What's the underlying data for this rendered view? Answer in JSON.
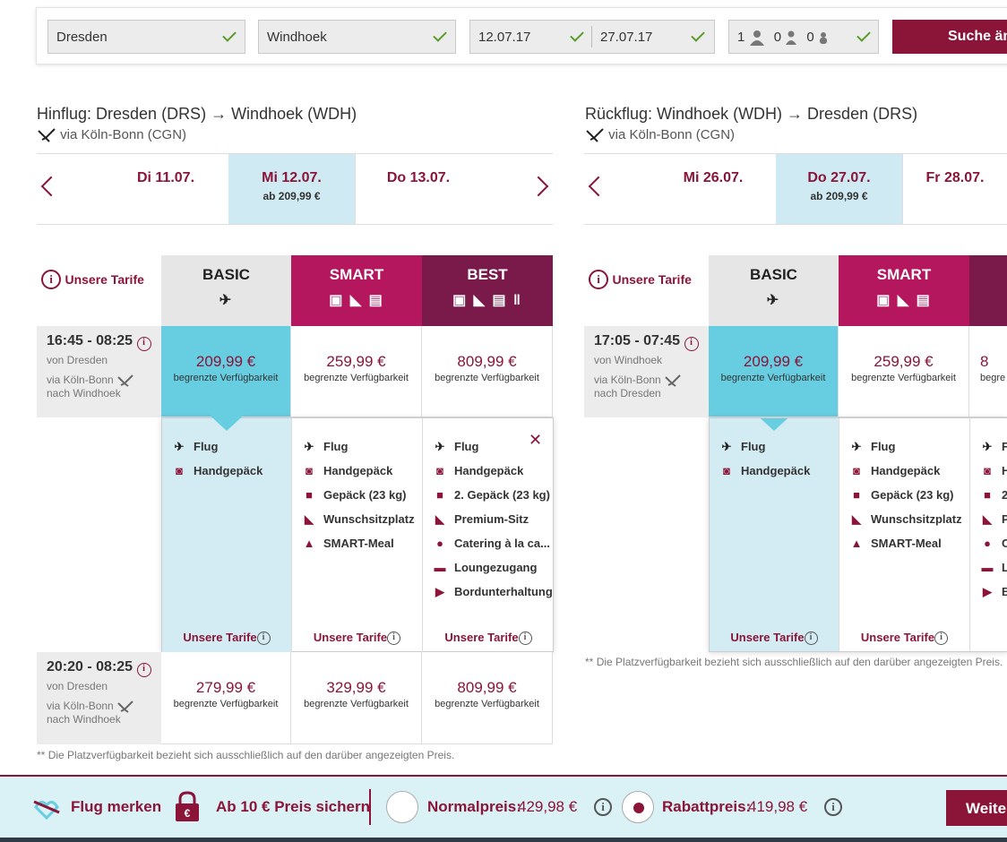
{
  "search": {
    "from": "Dresden",
    "to": "Windhoek",
    "depart_date": "12.07.17",
    "return_date": "27.07.17",
    "adults": "1",
    "children": "0",
    "infants": "0",
    "search_button": "Suche änd"
  },
  "outbound": {
    "title": "Hinflug: Dresden (DRS) → Windhoek (WDH)",
    "via": "via Köln-Bonn (CGN)",
    "dates": [
      {
        "label": "Di 11.07.",
        "sub": ""
      },
      {
        "label": "Mi 12.07.",
        "sub": "ab 209,99 €"
      },
      {
        "label": "Do 13.07.",
        "sub": ""
      }
    ],
    "tarife_label": "Unsere Tarife",
    "tariffs": [
      "BASIC",
      "SMART",
      "BEST"
    ],
    "flights": [
      {
        "time": "16:45 - 08:25",
        "from": "von Dresden",
        "via": "via Köln-Bonn",
        "to": "nach Windhoek",
        "prices": [
          {
            "price": "209,99 €",
            "avail": "begrenzte Verfügbarkeit"
          },
          {
            "price": "259,99 €",
            "avail": "begrenzte Verfügbarkeit"
          },
          {
            "price": "809,99 €",
            "avail": "begrenzte Verfügbarkeit"
          }
        ]
      },
      {
        "time": "20:20 - 08:25",
        "from": "von Dresden",
        "via": "via Köln-Bonn",
        "to": "nach Windhoek",
        "prices": [
          {
            "price": "279,99 €",
            "avail": "begrenzte Verfügbarkeit"
          },
          {
            "price": "329,99 €",
            "avail": "begrenzte Verfügbarkeit"
          },
          {
            "price": "809,99 €",
            "avail": "begrenzte Verfügbarkeit"
          }
        ]
      }
    ],
    "features": {
      "basic": [
        "Flug",
        "Handgepäck"
      ],
      "smart": [
        "Flug",
        "Handgepäck",
        "Gepäck (23 kg)",
        "Wunschsitzplatz",
        "SMART-Meal"
      ],
      "best": [
        "Flug",
        "Handgepäck",
        "2. Gepäck (23 kg)",
        "Premium-Sitz",
        "Catering à la ca...",
        "Loungezugang",
        "Bordunterhaltung"
      ]
    },
    "footnote": "Die Platzverfügbarkeit bezieht sich ausschließlich auf den darüber angezeigten Preis."
  },
  "return": {
    "title": "Rückflug: Windhoek (WDH) → Dresden (DRS)",
    "via": "via Köln-Bonn (CGN)",
    "dates": [
      {
        "label": "Mi 26.07.",
        "sub": ""
      },
      {
        "label": "Do 27.07.",
        "sub": "ab 209,99 €"
      },
      {
        "label": "Fr 28.07.",
        "sub": ""
      }
    ],
    "tarife_label": "Unsere Tarife",
    "tariffs": [
      "BASIC",
      "SMART"
    ],
    "flights": [
      {
        "time": "17:05 - 07:45",
        "from": "von Windhoek",
        "via": "via Köln-Bonn",
        "to": "nach Dresden",
        "prices": [
          {
            "price": "209,99 €",
            "avail": "begrenzte Verfügbarkeit"
          },
          {
            "price": "259,99 €",
            "avail": "begrenzte Verfügbarkeit"
          },
          {
            "price": "8",
            "avail": "begre"
          }
        ]
      }
    ],
    "features": {
      "basic": [
        "Flug",
        "Handgepäck"
      ],
      "smart": [
        "Flug",
        "Handgepäck",
        "Gepäck (23 kg)",
        "Wunschsitzplatz",
        "SMART-Meal"
      ],
      "best": [
        "F",
        "H",
        "2",
        "P",
        "C",
        "L",
        "B"
      ]
    },
    "footnote": "Die Platzverfügbarkeit bezieht sich ausschließlich auf den darüber angezeigten Preis."
  },
  "footnote_marker": "**",
  "bottom": {
    "merken": "Flug merken",
    "sichern": "Ab 10 € Preis sichern",
    "normal_label": "Normalpreis:",
    "normal_price": "429,98 €",
    "rabatt_label": "Rabattpreis:",
    "rabatt_price": "419,98 €",
    "weiter": "Weiter"
  },
  "colors": {
    "brand": "#8a1538",
    "smart": "#b5175f",
    "best": "#7a1a4a",
    "selected": "#67cde0",
    "bottom_bg": "#daf1f6"
  }
}
